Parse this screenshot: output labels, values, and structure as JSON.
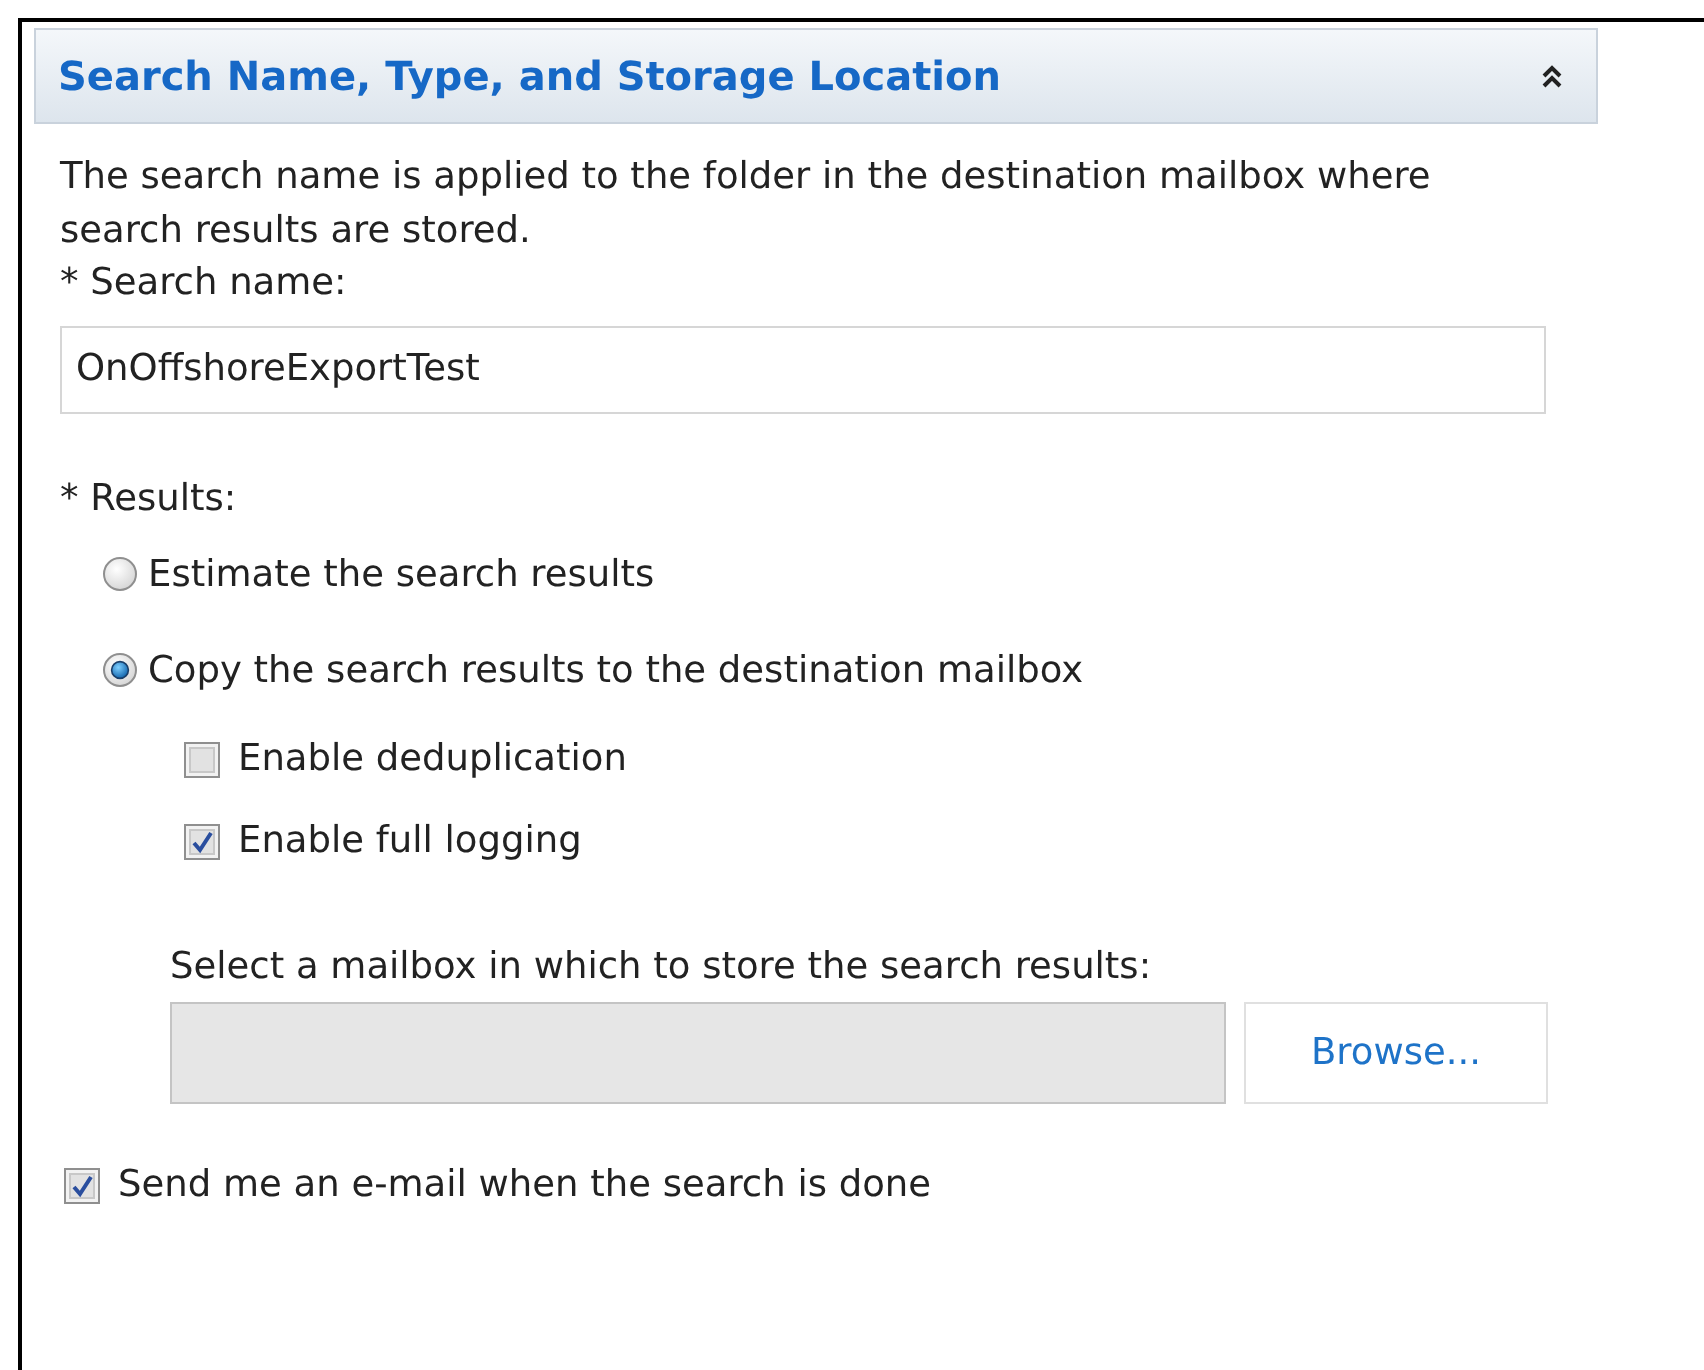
{
  "section": {
    "title": "Search Name, Type, and Storage Location",
    "expanded": true
  },
  "description": "The search name is applied to the folder in the destination mailbox where search results are stored.",
  "search_name": {
    "label": "* Search name:",
    "value": "OnOffshoreExportTest"
  },
  "results": {
    "label": "* Results:",
    "options": [
      {
        "label": "Estimate the search results",
        "selected": false
      },
      {
        "label": "Copy the search results to the destination mailbox",
        "selected": true
      }
    ],
    "copy_options": [
      {
        "label": "Enable deduplication",
        "checked": false
      },
      {
        "label": "Enable full logging",
        "checked": true
      }
    ],
    "mailbox_label": "Select a mailbox in which to store the search results:",
    "mailbox_field": {
      "disabled": true
    },
    "browse_button": "Browse..."
  },
  "notify": {
    "label": "Send me an e-mail when the search is done",
    "checked": true
  }
}
